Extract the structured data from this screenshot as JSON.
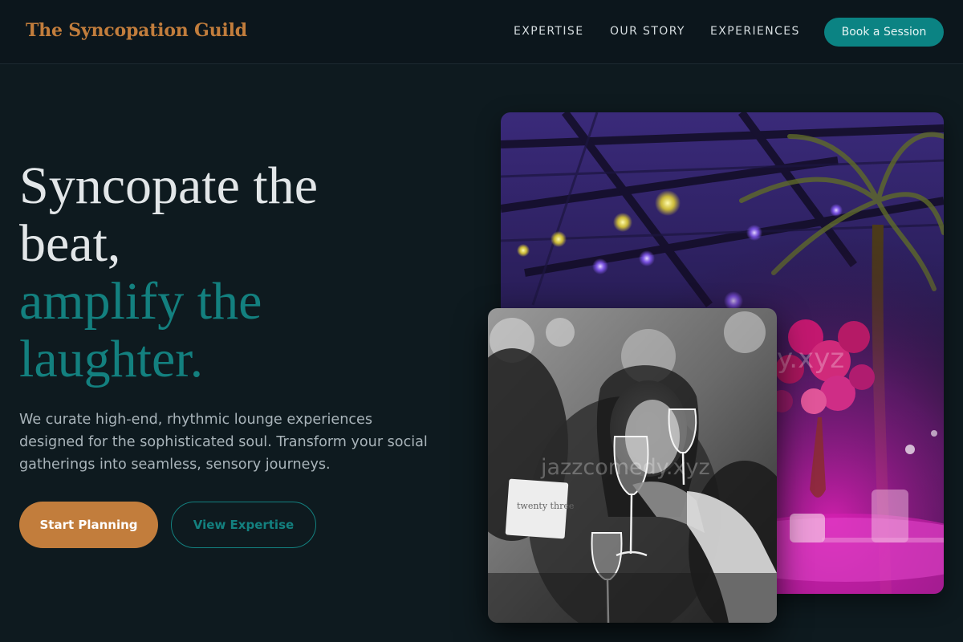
{
  "brand": {
    "name": "The Syncopation Guild"
  },
  "nav": {
    "links": [
      "EXPERTISE",
      "OUR STORY",
      "EXPERIENCES"
    ],
    "cta_label": "Book a Session"
  },
  "hero": {
    "title_line_1": "Syncopate the",
    "title_line_2": "beat,",
    "title_line_3": "amplify the",
    "title_line_4": "laughter.",
    "description": "We curate high-end, rhythmic lounge experiences designed for the sophisticated soul. Transform your social gatherings into seamless, sensory journeys.",
    "primary_cta": "Start Planning",
    "secondary_cta": "View Expertise"
  },
  "images": {
    "lounge_watermark": "y.xyz",
    "toast_watermark": "jazzcomedy.xyz"
  },
  "colors": {
    "background": "#0e1a1f",
    "header": "#0c161c",
    "brand": "#c27d3c",
    "accent_teal": "#13807f",
    "button_teal": "#0b8383",
    "primary_orange": "#c27d3c"
  }
}
